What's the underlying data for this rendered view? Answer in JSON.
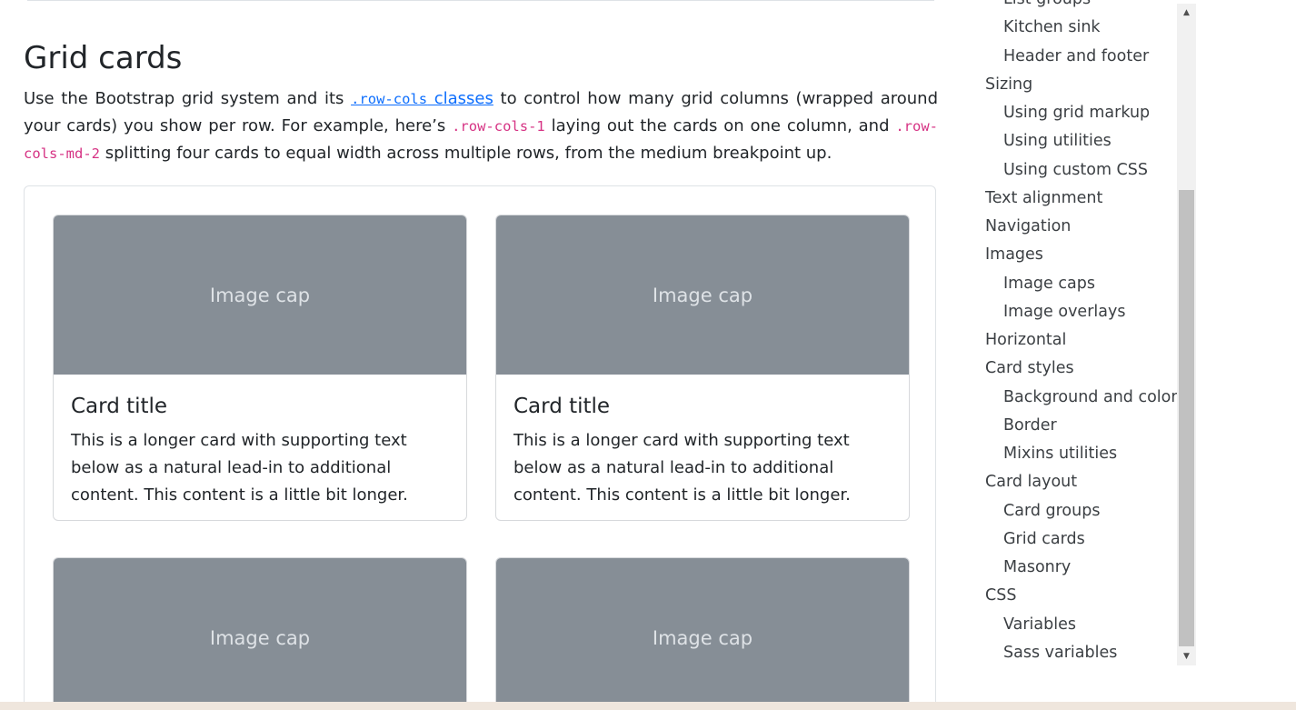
{
  "main": {
    "title": "Grid cards",
    "para": {
      "t1": "Use the Bootstrap grid system and its ",
      "link_code": ".row-cols",
      "link_text": " classes",
      "t2": " to control how many grid columns (wrapped around your cards) you show per row. For example, here’s ",
      "code1": ".row-cols-1",
      "t3": " laying out the cards on one column, and ",
      "code2": ".row-cols-md-2",
      "t4": " splitting four cards to equal width across multiple rows, from the medium breakpoint up."
    }
  },
  "cards": [
    {
      "cap": "Image cap",
      "title": "Card title",
      "text": "This is a longer card with supporting text below as a natural lead-in to additional content. This content is a little bit longer."
    },
    {
      "cap": "Image cap",
      "title": "Card title",
      "text": "This is a longer card with supporting text below as a natural lead-in to additional content. This content is a little bit longer."
    },
    {
      "cap": "Image cap"
    },
    {
      "cap": "Image cap"
    }
  ],
  "toc": [
    {
      "label": "List groups"
    },
    {
      "label": "Kitchen sink"
    },
    {
      "label": "Header and footer"
    },
    {
      "label": "Sizing"
    },
    {
      "label": "Using grid markup"
    },
    {
      "label": "Using utilities"
    },
    {
      "label": "Using custom CSS"
    },
    {
      "label": "Text alignment"
    },
    {
      "label": "Navigation"
    },
    {
      "label": "Images"
    },
    {
      "label": "Image caps"
    },
    {
      "label": "Image overlays"
    },
    {
      "label": "Horizontal"
    },
    {
      "label": "Card styles"
    },
    {
      "label": "Background and color"
    },
    {
      "label": "Border"
    },
    {
      "label": "Mixins utilities"
    },
    {
      "label": "Card layout"
    },
    {
      "label": "Card groups"
    },
    {
      "label": "Grid cards"
    },
    {
      "label": "Masonry"
    },
    {
      "label": "CSS"
    },
    {
      "label": "Variables"
    },
    {
      "label": "Sass variables"
    }
  ],
  "scrollbar": {
    "up_icon": "triangle-up-icon",
    "down_icon": "triangle-down-icon"
  }
}
